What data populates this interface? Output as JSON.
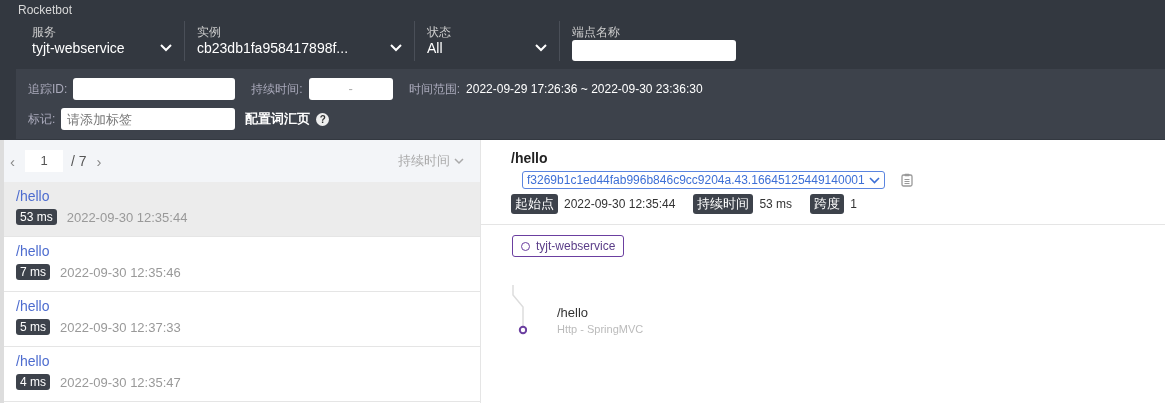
{
  "brand": "Rocketbot",
  "filters": [
    {
      "label": "服务",
      "value": "tyjt-webservice",
      "kind": "select"
    },
    {
      "label": "实例",
      "value": "cb23db1fa958417898f...",
      "kind": "select"
    },
    {
      "label": "状态",
      "value": "All",
      "kind": "select"
    },
    {
      "label": "端点名称",
      "kind": "input"
    }
  ],
  "trace_id": {
    "label": "追踪ID:"
  },
  "duration": {
    "label": "持续时间:",
    "separator": "-"
  },
  "time_range": {
    "label": "时间范围:",
    "value": "2022-09-29 17:26:36 ~ 2022-09-30 23:36:30"
  },
  "tags": {
    "label": "标记:",
    "placeholder": "请添加标签"
  },
  "vocab_link": "配置词汇页",
  "help_icon": "?",
  "pager": {
    "prev": "‹",
    "page": "1",
    "total": "/ 7",
    "next": "›",
    "sort": "持续时间"
  },
  "traces": [
    {
      "endpoint": "/hello",
      "duration": "53 ms",
      "time": "2022-09-30 12:35:44",
      "selected": true
    },
    {
      "endpoint": "/hello",
      "duration": "7 ms",
      "time": "2022-09-30 12:35:46",
      "selected": false
    },
    {
      "endpoint": "/hello",
      "duration": "5 ms",
      "time": "2022-09-30 12:37:33",
      "selected": false
    },
    {
      "endpoint": "/hello",
      "duration": "4 ms",
      "time": "2022-09-30 12:35:47",
      "selected": false
    }
  ],
  "detail": {
    "title": "/hello",
    "trace_select": "f3269b1c1ed44fab996b846c9cc9204a.43.16645125449140001",
    "meta": [
      {
        "label": "起始点",
        "value": "2022-09-30 12:35:44"
      },
      {
        "label": "持续时间",
        "value": "53 ms"
      },
      {
        "label": "跨度",
        "value": "1"
      }
    ],
    "service": "tyjt-webservice",
    "span": {
      "name": "/hello",
      "component": "Http - SpringMVC"
    }
  }
}
